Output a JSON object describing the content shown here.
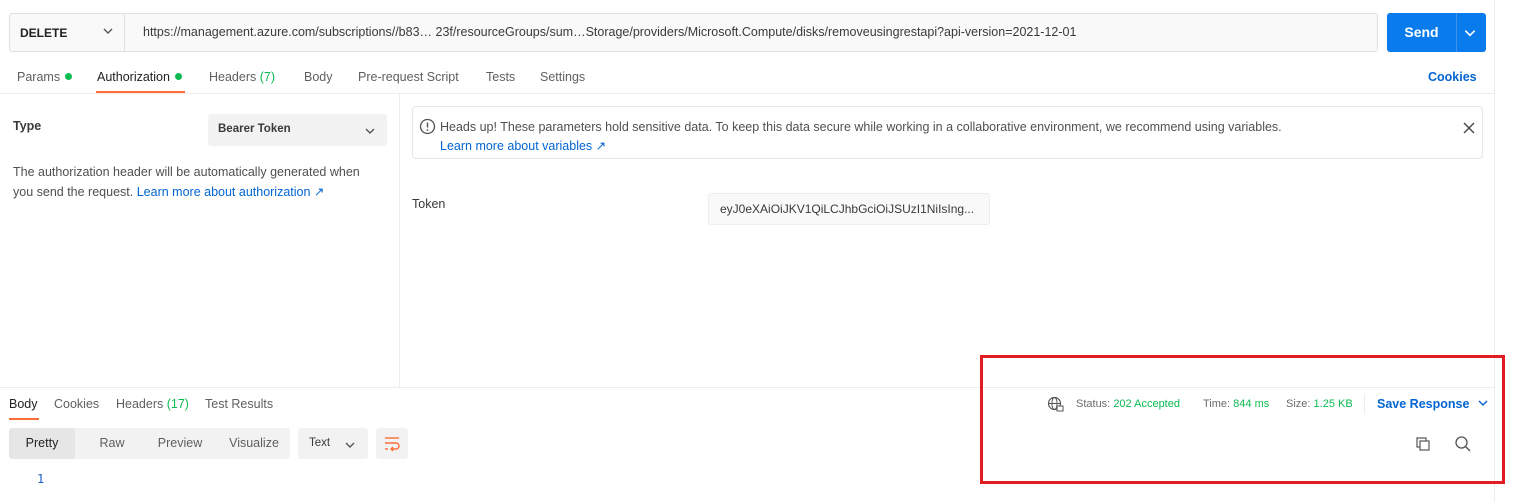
{
  "request": {
    "method": "DELETE",
    "url": "https://management.azure.com/subscriptions//b83… 23f/resourceGroups/sum…Storage/providers/Microsoft.Compute/disks/removeusingrestapi?api-version=2021-12-01",
    "send_label": "Send"
  },
  "tabs": [
    {
      "label": "Params",
      "dot": true
    },
    {
      "label": "Authorization",
      "dot": true
    },
    {
      "label": "Headers",
      "count": "(7)"
    },
    {
      "label": "Body"
    },
    {
      "label": "Pre-request Script"
    },
    {
      "label": "Tests"
    },
    {
      "label": "Settings"
    }
  ],
  "cookies_link": "Cookies",
  "auth": {
    "type_label": "Type",
    "type_value": "Bearer Token",
    "description": "The authorization header will be automatically generated when you send the request.",
    "learn_link": "Learn more about authorization ↗",
    "alert_text": "Heads up! These parameters hold sensitive data. To keep this data secure while working in a collaborative environment, we recommend using variables.",
    "alert_link": "Learn more about variables ↗",
    "token_label": "Token",
    "token_value": "eyJ0eXAiOiJKV1QiLCJhbGciOiJSUzI1NiIsIng..."
  },
  "response": {
    "tabs": [
      {
        "label": "Body"
      },
      {
        "label": "Cookies"
      },
      {
        "label": "Headers",
        "count": "(17)"
      },
      {
        "label": "Test Results"
      }
    ],
    "status_label": "Status:",
    "status_value": "202 Accepted",
    "time_label": "Time:",
    "time_value": "844 ms",
    "size_label": "Size:",
    "size_value": "1.25 KB",
    "save_label": "Save Response",
    "view_options": [
      "Pretty",
      "Raw",
      "Preview",
      "Visualize"
    ],
    "format": "Text",
    "line_number": "1"
  },
  "colors": {
    "accent": "#097bed",
    "tab_underline": "#ff6c37",
    "success": "#0cbb52",
    "link": "#0265d2",
    "highlight_box": "#e31b23"
  }
}
